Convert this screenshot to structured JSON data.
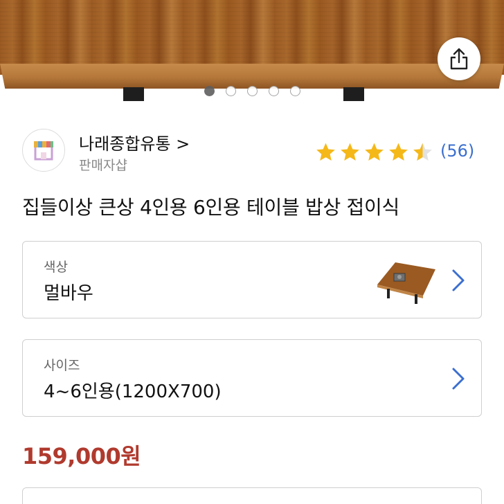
{
  "seller": {
    "name": "나래종합유통 >",
    "subtitle": "판매자샵",
    "review_count": "(56)",
    "rating": 4.5,
    "rating_max": 5
  },
  "product": {
    "title": "집들이상 큰상 4인용 6인용 테이블 밥상 접이식",
    "price": "159,000원"
  },
  "options": {
    "color": {
      "label": "색상",
      "value": "멀바우"
    },
    "size": {
      "label": "사이즈",
      "value": "4~6인용(1200X700)"
    }
  },
  "carousel": {
    "count": 5,
    "active_index": 0
  },
  "icons": {
    "share": "share-icon",
    "store": "store-icon",
    "star": "star-icon",
    "chevron": "chevron-right-icon"
  },
  "colors": {
    "price": "#b03a2e",
    "link": "#3b6fcf",
    "star": "#f5b819",
    "chevron": "#3b6fcf"
  }
}
